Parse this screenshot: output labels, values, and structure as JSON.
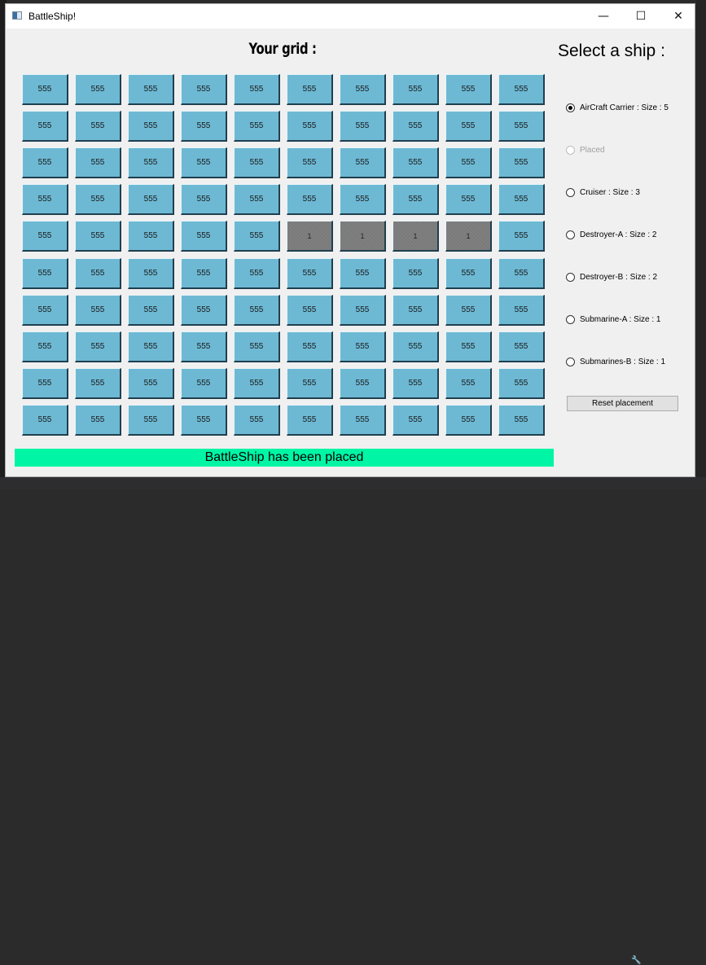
{
  "window": {
    "title": "BattleShip!",
    "minimize_glyph": "—",
    "maximize_glyph": "☐",
    "close_glyph": "✕"
  },
  "grid": {
    "title": "Your grid :",
    "rows": [
      [
        "555",
        "555",
        "555",
        "555",
        "555",
        "555",
        "555",
        "555",
        "555",
        "555"
      ],
      [
        "555",
        "555",
        "555",
        "555",
        "555",
        "555",
        "555",
        "555",
        "555",
        "555"
      ],
      [
        "555",
        "555",
        "555",
        "555",
        "555",
        "555",
        "555",
        "555",
        "555",
        "555"
      ],
      [
        "555",
        "555",
        "555",
        "555",
        "555",
        "555",
        "555",
        "555",
        "555",
        "555"
      ],
      [
        "555",
        "555",
        "555",
        "555",
        "555",
        "1",
        "1",
        "1",
        "1",
        "555"
      ],
      [
        "555",
        "555",
        "555",
        "555",
        "555",
        "555",
        "555",
        "555",
        "555",
        "555"
      ],
      [
        "555",
        "555",
        "555",
        "555",
        "555",
        "555",
        "555",
        "555",
        "555",
        "555"
      ],
      [
        "555",
        "555",
        "555",
        "555",
        "555",
        "555",
        "555",
        "555",
        "555",
        "555"
      ],
      [
        "555",
        "555",
        "555",
        "555",
        "555",
        "555",
        "555",
        "555",
        "555",
        "555"
      ],
      [
        "555",
        "555",
        "555",
        "555",
        "555",
        "555",
        "555",
        "555",
        "555",
        "555"
      ]
    ],
    "placed_value": "1"
  },
  "status": {
    "text": "BattleShip has been placed",
    "color": "#00f5a5"
  },
  "ship_select": {
    "title": "Select a ship :",
    "options": [
      {
        "label": "AirCraft Carrier : Size : 5",
        "checked": true,
        "disabled": false
      },
      {
        "label": "Placed",
        "checked": false,
        "disabled": true
      },
      {
        "label": "Cruiser : Size : 3",
        "checked": false,
        "disabled": false
      },
      {
        "label": "Destroyer-A : Size : 2",
        "checked": false,
        "disabled": false
      },
      {
        "label": "Destroyer-B : Size : 2",
        "checked": false,
        "disabled": false
      },
      {
        "label": "Submarine-A : Size : 1",
        "checked": false,
        "disabled": false
      },
      {
        "label": "Submarines-B : Size : 1",
        "checked": false,
        "disabled": false
      }
    ],
    "reset_label": "Reset placement"
  },
  "colors": {
    "cell": "#6db9d4",
    "placed_cell": "#7a7a7a",
    "status_bar": "#00f5a5"
  }
}
